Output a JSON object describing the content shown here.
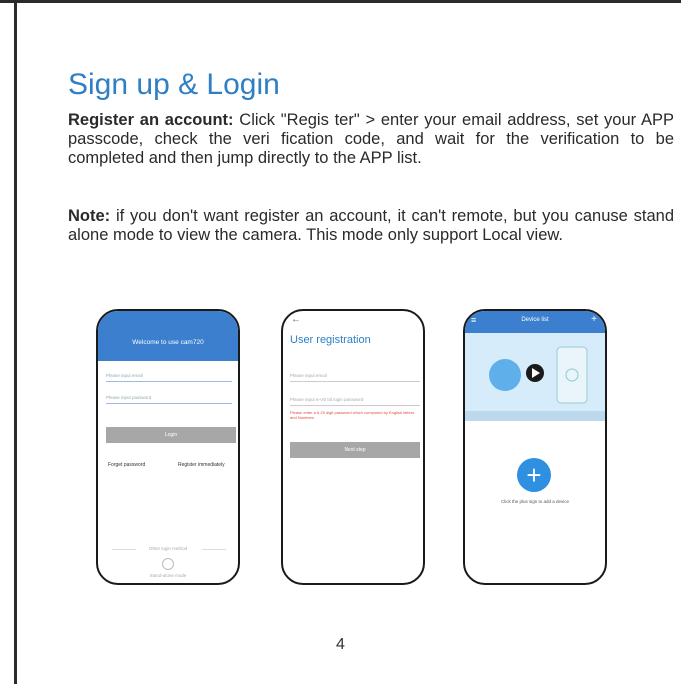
{
  "title": "Sign up & Login",
  "para1": {
    "label": "Register an account:",
    "text": " Click \"Regis ter\" > enter your email address, set your APP passcode, check the veri      fication code, and wait for the verification to be completed  and then jump directly to the APP list."
  },
  "para2": {
    "label": "Note:",
    "text": " if you don't want register  an account,  it can't remote,  but you canuse  stand alone mode to view the camera.  This mode only support Local view."
  },
  "phone1": {
    "welcome": "Welcome to use cam720",
    "email_placeholder": "Please input email",
    "password_placeholder": "Please input password",
    "login": "Login",
    "forget": "Forget password",
    "register": "Register immediately",
    "other": "Other login method",
    "standalone": "Stand-alone mode"
  },
  "phone2": {
    "back": "←",
    "title": "User registration",
    "email_placeholder": "Please input email",
    "password_placeholder": "Please input 6~20 bit login password",
    "warning": "Please enter a 6-20 digit password which composed by English letters and Numbers",
    "next": "Next step"
  },
  "phone3": {
    "menu": "≡",
    "title": "Device list",
    "plus_top": "+",
    "fab": "+",
    "hint": "Click the plus sign to add a device"
  },
  "page_number": "4"
}
